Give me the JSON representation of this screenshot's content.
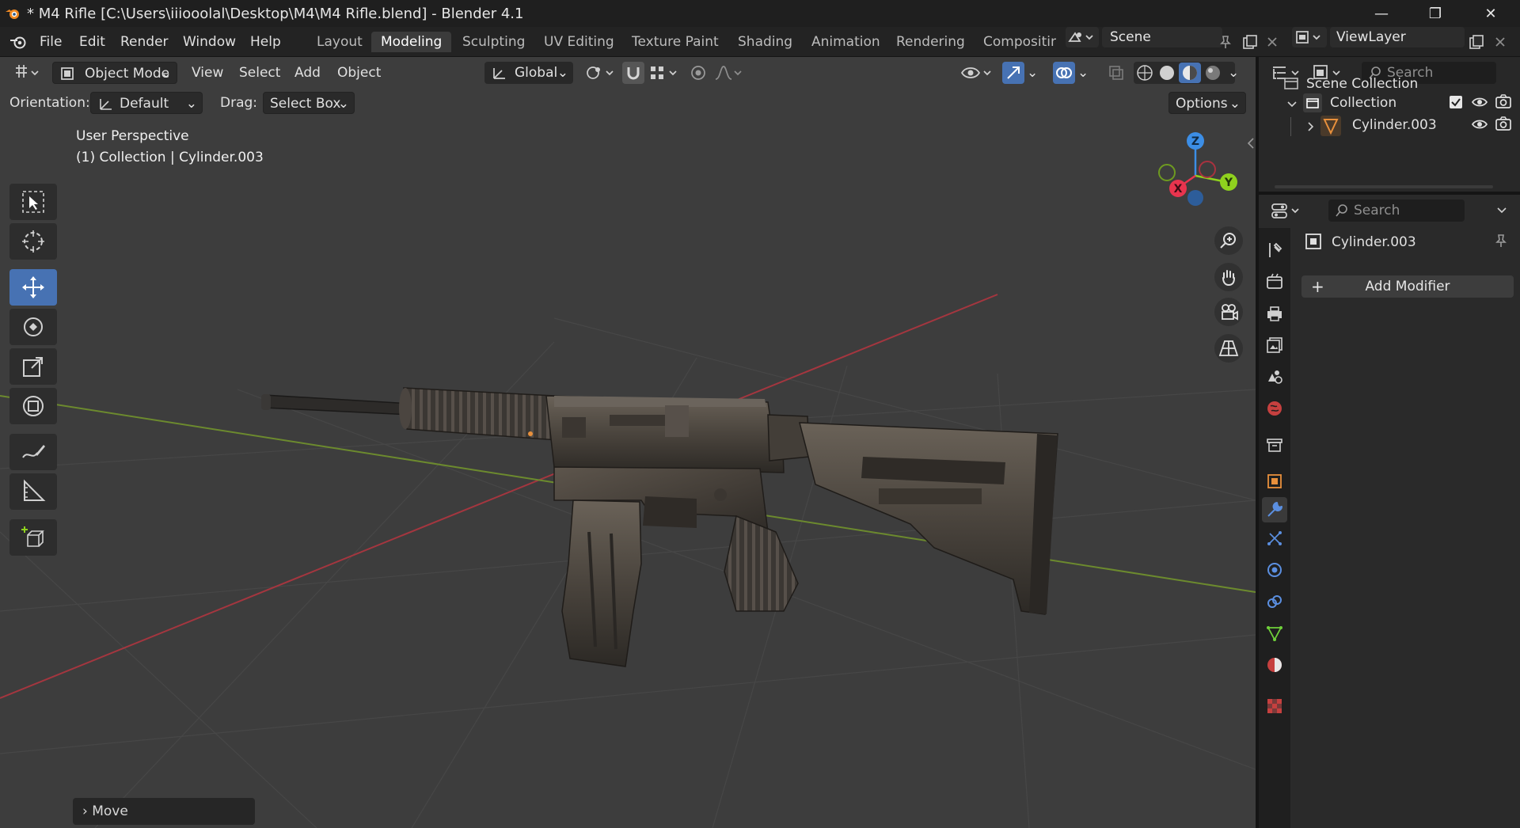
{
  "window": {
    "title": "* M4 Rifle [C:\\Users\\iiiooolal\\Desktop\\M4\\M4 Rifle.blend] - Blender 4.1",
    "controls": {
      "minimize": "—",
      "maximize": "❐",
      "close": "✕"
    }
  },
  "menu": {
    "items": [
      {
        "label": "File"
      },
      {
        "label": "Edit"
      },
      {
        "label": "Render"
      },
      {
        "label": "Window"
      },
      {
        "label": "Help"
      }
    ]
  },
  "workspaces": {
    "tabs": [
      {
        "label": "Layout"
      },
      {
        "label": "Modeling",
        "active": true
      },
      {
        "label": "Sculpting"
      },
      {
        "label": "UV Editing"
      },
      {
        "label": "Texture Paint"
      },
      {
        "label": "Shading"
      },
      {
        "label": "Animation"
      },
      {
        "label": "Rendering"
      },
      {
        "label": "Compositing"
      }
    ]
  },
  "scene": {
    "name": "Scene"
  },
  "view_layer": {
    "name": "ViewLayer"
  },
  "viewport_header": {
    "mode": "Object Mode",
    "menus": [
      {
        "label": "View"
      },
      {
        "label": "Select"
      },
      {
        "label": "Add"
      },
      {
        "label": "Object"
      }
    ],
    "transform_orientation": "Global",
    "options": "Options"
  },
  "tool_settings": {
    "orientation_label": "Orientation:",
    "orientation_value": "Default",
    "drag_label": "Drag:",
    "drag_value": "Select Box"
  },
  "viewport_info": {
    "line1": "User Perspective",
    "line2": "(1) Collection | Cylinder.003"
  },
  "gizmo": {
    "x": "X",
    "y": "Y",
    "z": "Z"
  },
  "last_operator": {
    "label": "Move",
    "arrow": "›"
  },
  "outliner": {
    "search_placeholder": "Search",
    "root": "Scene Collection",
    "collection": "Collection",
    "object": "Cylinder.003"
  },
  "properties": {
    "search_placeholder": "Search",
    "object_name": "Cylinder.003",
    "add_modifier": "Add Modifier",
    "add_plus": "+"
  },
  "colors": {
    "accent": "#4772b3",
    "axis_x": "#e8344e",
    "axis_y": "#8fd11e",
    "axis_z": "#3c8ee6",
    "viewport_bg": "#3d3d3d",
    "object_orange": "#e8903c"
  }
}
